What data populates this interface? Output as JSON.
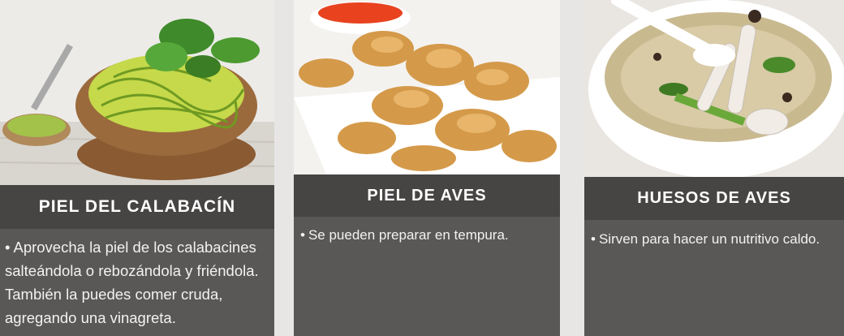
{
  "cards": [
    {
      "title": "PIEL DEL CALABACÍN",
      "bullet": "•",
      "text": "Aprovecha la piel de los calabacines salteándola o rebozándola y friéndola. También la puedes comer cruda, agregando una vinagreta."
    },
    {
      "title": "PIEL DE AVES",
      "bullet": "•",
      "text": "Se pueden preparar en tempura."
    },
    {
      "title": "HUESOS DE AVES",
      "bullet": "•",
      "text": "Sirven para hacer un nutritivo caldo."
    }
  ]
}
